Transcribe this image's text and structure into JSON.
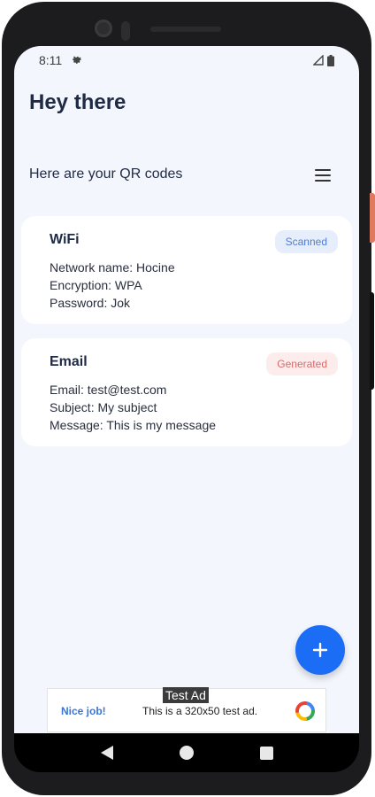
{
  "status": {
    "time": "8:11"
  },
  "header": {
    "title": "Hey there",
    "subtitle": "Here are your QR codes"
  },
  "cards": [
    {
      "title": "WiFi",
      "badge": "Scanned",
      "lines": [
        "Network name: Hocine",
        "Encryption: WPA",
        "Password: Jok"
      ]
    },
    {
      "title": "Email",
      "badge": "Generated",
      "lines": [
        "Email: test@test.com",
        "Subject: My subject",
        "Message: This is my message"
      ]
    }
  ],
  "fab": {
    "icon": "plus-icon",
    "label": "+"
  },
  "ad": {
    "tag": "Test Ad",
    "nice": "Nice job!",
    "text": "This is a 320x50 test ad."
  },
  "colors": {
    "background": "#f3f6fd",
    "fab": "#1b6df5",
    "scanned_badge": "#e6eefb",
    "generated_badge": "#fdecec"
  }
}
